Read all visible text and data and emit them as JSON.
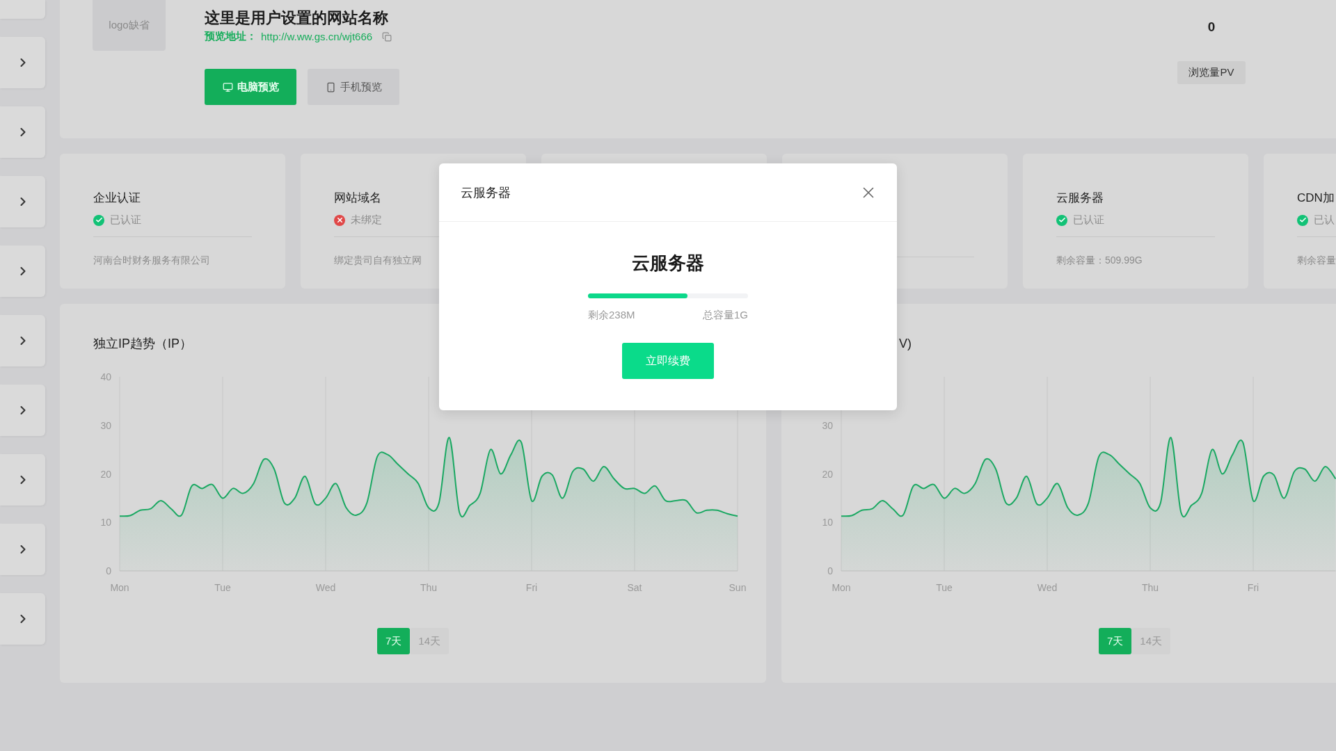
{
  "sidebar": {
    "items": [
      {
        "kind": "cut"
      },
      {
        "kind": "expand"
      },
      {
        "kind": "expand"
      },
      {
        "kind": "expand"
      },
      {
        "kind": "expand"
      },
      {
        "kind": "expand"
      },
      {
        "kind": "expand"
      },
      {
        "kind": "expand"
      },
      {
        "kind": "expand"
      },
      {
        "kind": "expand"
      }
    ]
  },
  "site": {
    "logo": "logo缺省",
    "title": "这里是用户设置的网站名称",
    "url_label": "预览地址：",
    "url": "http://w.ww.gs.cn/wjt666",
    "buttons": [
      {
        "label": "电脑预览",
        "selected": true,
        "kind": "desktop"
      },
      {
        "label": "手机预览",
        "selected": false,
        "kind": "mobile"
      }
    ],
    "stat": {
      "value": "0",
      "label": "浏览量PV"
    }
  },
  "cards": [
    {
      "kind": "info",
      "title": "企业认证",
      "verified": true,
      "status": "已认证",
      "desc": "河南合时财务服务有限公司"
    },
    {
      "kind": "info",
      "title": "网站域名",
      "verified": false,
      "status": "未绑定",
      "desc": "绑定贵司自有独立网"
    },
    {
      "kind": "blank"
    },
    {
      "kind": "divider"
    },
    {
      "kind": "info",
      "title": "云服务器",
      "verified": true,
      "status": "已认证",
      "desc": "剩余容量：509.99G"
    },
    {
      "kind": "info",
      "title": "CDN加",
      "verified": true,
      "status": "已认",
      "desc": "剩余容量"
    }
  ],
  "charts": [
    {
      "title": "独立IP趋势（IP）",
      "ranges": [
        {
          "label": "7天",
          "selected": true
        },
        {
          "label": "14天",
          "selected": false
        }
      ],
      "chart_data": {
        "type": "area",
        "categories": [
          "Mon",
          null,
          null,
          null,
          null,
          null,
          null,
          null,
          null,
          null,
          "Tue",
          null,
          null,
          null,
          null,
          null,
          null,
          null,
          null,
          null,
          "Wed",
          null,
          null,
          null,
          null,
          null,
          null,
          null,
          null,
          null,
          "Thu",
          null,
          null,
          null,
          null,
          null,
          null,
          null,
          null,
          null,
          "Fri",
          null,
          null,
          null,
          null,
          null,
          null,
          null,
          null,
          null,
          "Sat",
          null,
          null,
          null,
          null,
          null,
          null,
          null,
          null,
          null,
          "Sun"
        ],
        "grid": true,
        "series": [
          {
            "color": "#1aa862",
            "values": [
              11.3,
              11.4,
              12.5,
              12.8,
              14.5,
              12.8,
              11.5,
              17.5,
              17,
              17.8,
              15,
              17,
              16,
              18,
              23,
              21,
              14,
              15,
              19.5,
              13.8,
              15,
              18,
              13,
              11.5,
              14,
              23.5,
              24,
              22,
              20,
              18,
              13,
              14,
              27.5,
              12,
              13.5,
              16,
              25,
              20,
              24,
              26.5,
              14.5,
              19.5,
              19.8,
              15,
              20.5,
              21,
              18.5,
              21.5,
              19,
              17,
              17,
              16,
              17.5,
              14.5,
              14.5,
              14.5,
              12,
              12.5,
              12.5,
              11.8,
              11.3
            ]
          }
        ],
        "ylim": [
          0,
          40
        ],
        "yticks": [
          0,
          10,
          20,
          30,
          40
        ]
      }
    },
    {
      "title": "V)",
      "ranges": [
        {
          "label": "7天",
          "selected": true
        },
        {
          "label": "14天",
          "selected": false
        }
      ],
      "chart_data": {
        "type": "area",
        "categories": [
          "Mon",
          null,
          null,
          null,
          null,
          null,
          null,
          null,
          null,
          null,
          "Tue",
          null,
          null,
          null,
          null,
          null,
          null,
          null,
          null,
          null,
          "Wed",
          null,
          null,
          null,
          null,
          null,
          null,
          null,
          null,
          null,
          "Thu",
          null,
          null,
          null,
          null,
          null,
          null,
          null,
          null,
          null,
          "Fri",
          null,
          null,
          null,
          null,
          null,
          null,
          null,
          null
        ],
        "grid": true,
        "series": [
          {
            "color": "#1aa862",
            "values": [
              11.3,
              11.4,
              12.5,
              12.8,
              14.5,
              12.8,
              11.5,
              17.5,
              17,
              17.8,
              15,
              17,
              16,
              18,
              23,
              21,
              14,
              15,
              19.5,
              13.8,
              15,
              18,
              13,
              11.5,
              14,
              23.5,
              24,
              22,
              20,
              18,
              13,
              14,
              27.5,
              12,
              13.5,
              16,
              25,
              20,
              24,
              26.5,
              14.5,
              19.5,
              19.8,
              15,
              20.5,
              21,
              18.5,
              21.5,
              19
            ]
          }
        ],
        "ylim": [
          0,
          40
        ],
        "yticks": [
          0,
          10,
          20,
          30
        ]
      }
    }
  ],
  "modal": {
    "title": "云服务器",
    "heading": "云服务器",
    "level": 0.62,
    "remaining": "剩余238M",
    "total": "总容量1G",
    "button": "立即续费"
  }
}
